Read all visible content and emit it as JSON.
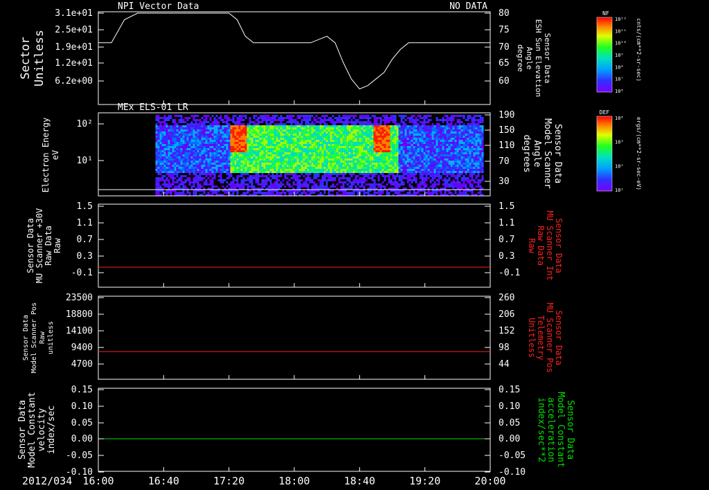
{
  "colors": {
    "white": "#ffffff",
    "red": "#ff2020",
    "green": "#00e000"
  },
  "time_axis": {
    "date_label": "2012/034",
    "ticks": [
      "16:00",
      "16:40",
      "17:20",
      "18:00",
      "18:40",
      "19:20",
      "20:00"
    ],
    "range_hours": [
      16,
      20
    ]
  },
  "panels": [
    {
      "id": "p1",
      "title_left": "NPI Vector Data",
      "title_right": "NO DATA",
      "left_label": [
        "Sector",
        "Unitless"
      ],
      "left_ticks": [
        "3.1e+01",
        "2.5e+01",
        "1.9e+01",
        "1.2e+01",
        "6.2e+00"
      ],
      "right_label": [
        "Sensor Data",
        "ESH Sun Elevation",
        "Angle",
        "degree"
      ],
      "right_ticks": [
        "80",
        "75",
        "70",
        "65",
        "60"
      ],
      "colorbar": {
        "label": "NF",
        "unit": "cnts/(cm**2-sr-sec)",
        "ticks": [
          "10¹²",
          "10¹¹",
          "10¹⁰",
          "10⁹",
          "10⁸",
          "10⁷",
          "10⁶"
        ]
      }
    },
    {
      "id": "p2",
      "title_left": "MEx ELS-01 LR",
      "left_label": [
        "Electron Energy",
        "eV"
      ],
      "left_ticks": [
        "10²",
        "10¹"
      ],
      "right_label": [
        "Sensor Data",
        "Model Scanner",
        "Angle",
        "degrees"
      ],
      "right_ticks": [
        "190",
        "150",
        "110",
        "70",
        "30"
      ],
      "colorbar": {
        "label": "DEF",
        "unit": "ergs/(cm**2-sr-sec-eV)",
        "ticks": [
          "10⁴",
          "10³",
          "10²",
          "10¹"
        ]
      }
    },
    {
      "id": "p3",
      "left_label": [
        "Sensor Data",
        "MU Scanner +30V",
        "Raw Data",
        "Raw"
      ],
      "left_ticks": [
        "1.5",
        "1.1",
        "0.7",
        "0.3",
        "-0.1"
      ],
      "right_label": [
        "Sensor Data",
        "MU Scanner Int",
        "Raw Data",
        "Raw"
      ],
      "right_ticks": [
        "1.5",
        "1.1",
        "0.7",
        "0.3",
        "-0.1"
      ]
    },
    {
      "id": "p4",
      "left_label": [
        "Sensor Data",
        "Model Scanner Pos",
        "Raw",
        "unitless"
      ],
      "left_ticks": [
        "23500",
        "18800",
        "14100",
        "9400",
        "4700"
      ],
      "right_label": [
        "Sensor Data",
        "MU Scanner Pos",
        "Telemetry",
        "Unitless"
      ],
      "right_ticks": [
        "260",
        "206",
        "152",
        "98",
        "44"
      ]
    },
    {
      "id": "p5",
      "left_label": [
        "Sensor Data",
        "Model Constant",
        "velocity",
        "index/sec"
      ],
      "left_ticks": [
        "0.15",
        "0.10",
        "0.05",
        "0.00",
        "-0.05",
        "-0.10"
      ],
      "right_label": [
        "Sensor Data",
        "Model Constant",
        "acceleration",
        "index/sec**2"
      ],
      "right_ticks": [
        "0.15",
        "0.10",
        "0.05",
        "0.00",
        "-0.05",
        "-0.10"
      ]
    }
  ],
  "chart_data": [
    {
      "type": "line",
      "series": [
        {
          "axis": "right",
          "x": [
            "16:00",
            "16:08",
            "16:16",
            "16:24",
            "17:20",
            "17:25",
            "17:30",
            "17:35",
            "17:40",
            "18:10",
            "18:20",
            "18:25",
            "18:30",
            "18:35",
            "18:40",
            "18:45",
            "18:50",
            "18:55",
            "19:00",
            "19:05",
            "19:10",
            "19:20",
            "20:00"
          ],
          "y": [
            71,
            71,
            78,
            80,
            80,
            78,
            73,
            71,
            71,
            71,
            73,
            71,
            65,
            60,
            57,
            58,
            60,
            62,
            66,
            69,
            71,
            71,
            71
          ]
        }
      ],
      "ylim_right": [
        55,
        80
      ]
    },
    {
      "type": "heatmap",
      "x_range": [
        "16:35",
        "19:55"
      ],
      "y_log_range": [
        0.3,
        2.3
      ],
      "ylabel": "Electron Energy",
      "note_features": [
        {
          "x": [
            "17:20",
            "17:28"
          ],
          "level": "high",
          "energy_eV": [
            30,
            150
          ]
        },
        {
          "x": [
            "18:48",
            "18:58"
          ],
          "level": "high",
          "energy_eV": [
            30,
            150
          ]
        }
      ]
    },
    {
      "type": "line",
      "series": [
        {
          "x": [
            "16:00",
            "20:00"
          ],
          "y": [
            0,
            0
          ]
        }
      ],
      "ylim": [
        -0.2,
        1.5
      ]
    },
    {
      "type": "line",
      "series": [
        {
          "x": [
            "16:00",
            "20:00"
          ],
          "y": [
            8100,
            8100
          ]
        }
      ],
      "ylim": [
        0,
        23500
      ]
    },
    {
      "type": "line",
      "series": [
        {
          "x": [
            "16:00",
            "20:00"
          ],
          "y": [
            0,
            0
          ]
        }
      ],
      "ylim": [
        -0.1,
        0.15
      ]
    }
  ]
}
